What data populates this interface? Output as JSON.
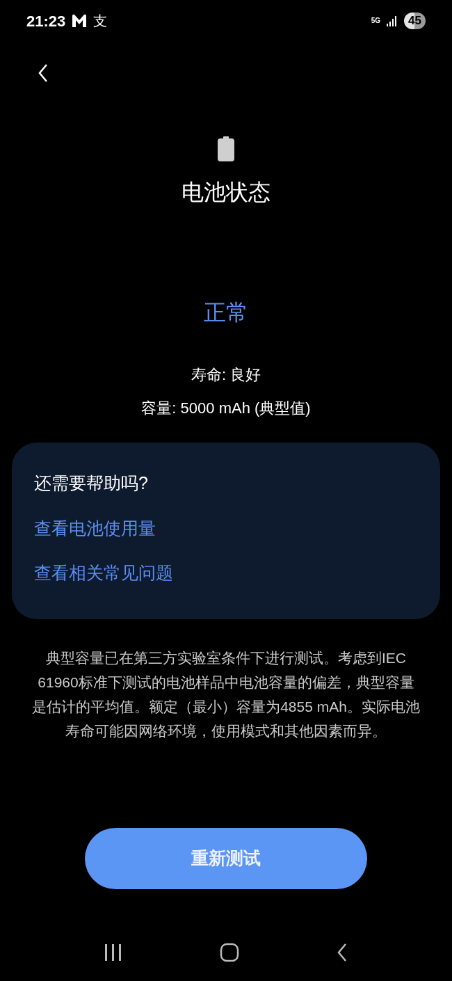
{
  "status_bar": {
    "time": "21:23",
    "app_glyph": "支",
    "network": "5G",
    "battery": "45"
  },
  "header": {
    "title": "电池状态"
  },
  "status": {
    "text": "正常"
  },
  "details": [
    "寿命: 良好",
    "容量: 5000 mAh (典型值)"
  ],
  "help_card": {
    "title": "还需要帮助吗?",
    "links": [
      "查看电池使用量",
      "查看相关常见问题"
    ]
  },
  "note": "典型容量已在第三方实验室条件下进行测试。考虑到IEC 61960标准下测试的电池样品中电池容量的偏差，典型容量是估计的平均值。额定（最小）容量为4855 mAh。实际电池寿命可能因网络环境，使用模式和其他因素而异。",
  "button": {
    "label": "重新测试"
  }
}
